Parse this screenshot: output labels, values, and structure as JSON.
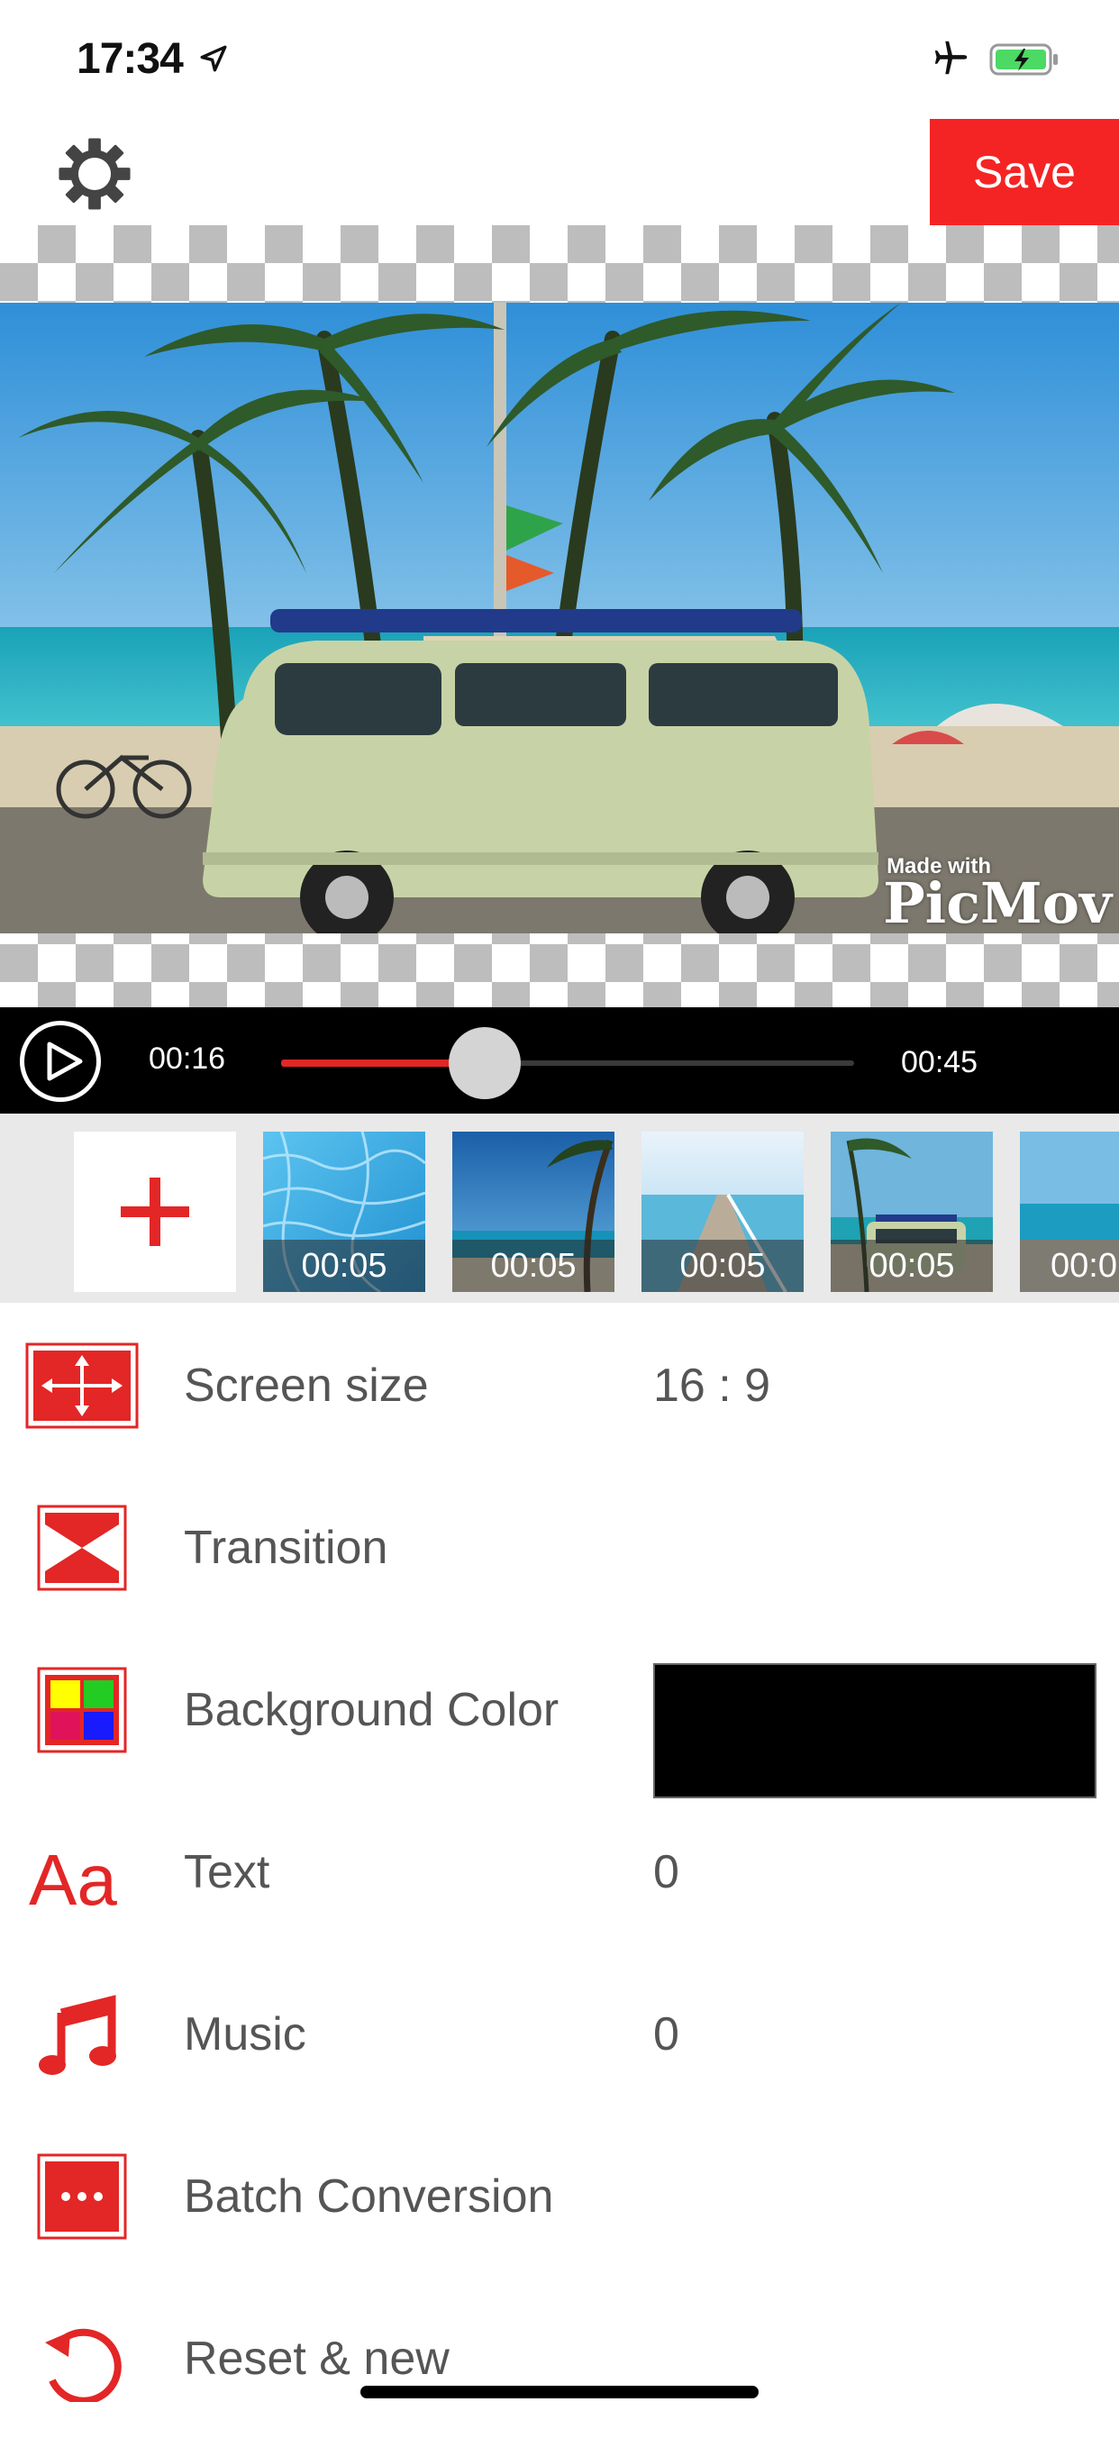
{
  "status_bar": {
    "time": "17:34"
  },
  "toolbar": {
    "save_label": "Save"
  },
  "preview": {
    "watermark_small": "Made with",
    "watermark_brand": "PicMov"
  },
  "player": {
    "current_time": "00:16",
    "total_time": "00:45",
    "progress": 0.355
  },
  "timeline": {
    "clips": [
      {
        "duration": "00:05"
      },
      {
        "duration": "00:05"
      },
      {
        "duration": "00:05"
      },
      {
        "duration": "00:05"
      },
      {
        "duration": "00:0"
      }
    ]
  },
  "settings": {
    "screen_size": {
      "label": "Screen size",
      "value": "16 : 9",
      "icon": "screen-size-icon"
    },
    "transition": {
      "label": "Transition",
      "icon": "transition-icon"
    },
    "background_color": {
      "label": "Background Color",
      "icon": "color-grid-icon",
      "color": "#000000"
    },
    "text": {
      "label": "Text",
      "value": "0",
      "icon": "text-aa-icon"
    },
    "music": {
      "label": "Music",
      "value": "0",
      "icon": "music-note-icon"
    },
    "batch_conversion": {
      "label": "Batch Conversion",
      "icon": "batch-icon"
    },
    "reset": {
      "label": "Reset & new",
      "icon": "reset-icon"
    }
  },
  "colors": {
    "accent": "#f52424",
    "player_bg": "#000000",
    "timeline_bg": "#e9e9e9"
  }
}
